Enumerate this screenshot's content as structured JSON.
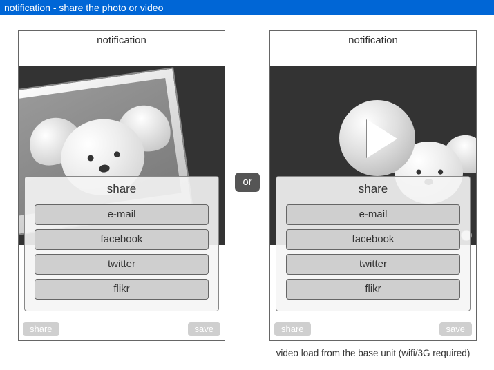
{
  "titlebar": "notification - share the photo or video",
  "connector": "or",
  "caption": "video load from the base unit (wifi/3G required)",
  "panels": {
    "left": {
      "header": "notification",
      "media_kind": "photo",
      "share": {
        "title": "share",
        "options": [
          "e-mail",
          "facebook",
          "twitter",
          "flikr"
        ]
      },
      "footer": {
        "left": "share",
        "right": "save"
      }
    },
    "right": {
      "header": "notification",
      "media_kind": "video",
      "share": {
        "title": "share",
        "options": [
          "e-mail",
          "facebook",
          "twitter",
          "flikr"
        ]
      },
      "footer": {
        "left": "share",
        "right": "save"
      }
    }
  }
}
